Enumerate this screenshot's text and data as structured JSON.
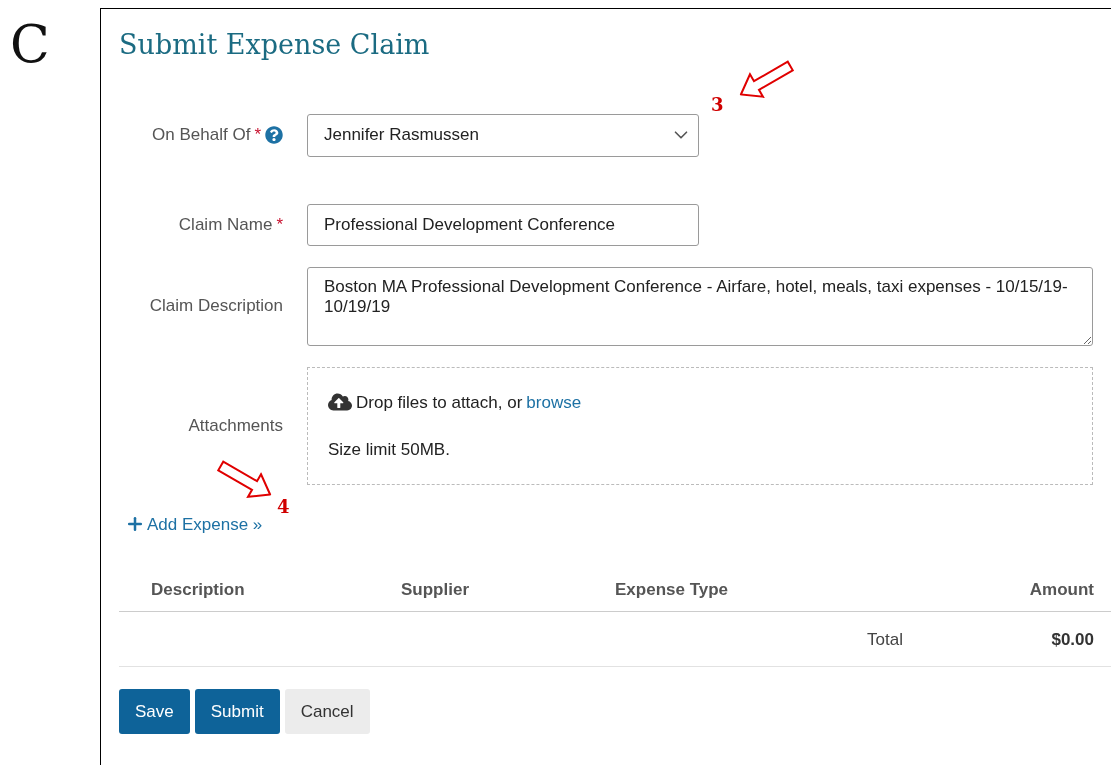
{
  "page_label": "C",
  "title": "Submit Expense Claim",
  "required_mark": "*",
  "fields": [
    {
      "kind": "select",
      "label": "On Behalf Of",
      "required": true,
      "help": true,
      "value": "Jennifer Rasmussen"
    },
    {
      "kind": "text",
      "label": "Claim Name",
      "required": true,
      "help": false,
      "value": "Professional Development Conference"
    },
    {
      "kind": "textarea",
      "label": "Claim Description",
      "required": false,
      "help": false,
      "value": "Boston MA Professional Development Conference - Airfare, hotel, meals, taxi expenses - 10/15/19-10/19/19"
    },
    {
      "kind": "dropzone",
      "label": "Attachments",
      "required": false,
      "help": false,
      "prompt": "Drop files to attach, or",
      "link": "browse",
      "note": "Size limit 50MB."
    }
  ],
  "add_expense": "Add Expense »",
  "table": {
    "columns": [
      "Description",
      "Supplier",
      "Expense Type",
      "Amount"
    ],
    "total_label": "Total",
    "total": "$0.00"
  },
  "buttons": [
    {
      "label": "Save",
      "kind": "primary"
    },
    {
      "label": "Submit",
      "kind": "primary"
    },
    {
      "label": "Cancel",
      "kind": "secondary"
    }
  ],
  "annotations": [
    {
      "label": "3"
    },
    {
      "label": "4"
    }
  ]
}
